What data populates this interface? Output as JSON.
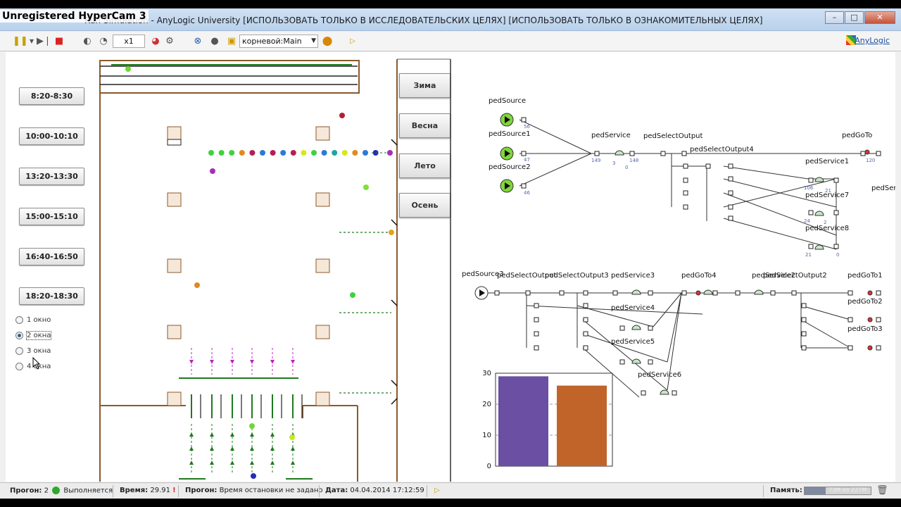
{
  "watermark": "Unregistered HyperCam 3",
  "window": {
    "title": "Run Simulation - AnyLogic University  [ИСПОЛЬЗОВАТЬ ТОЛЬКО В ИССЛЕДОВАТЕЛЬСКИХ ЦЕЛЯХ]  [ИСПОЛЬЗОВАТЬ ТОЛЬКО В ОЗНАКОМИТЕЛЬНЫХ ЦЕЛЯХ]",
    "minimize": "–",
    "maximize": "□",
    "close": "✕"
  },
  "toolbar": {
    "speed": "x1",
    "agent_select": "корневой:Main",
    "brand_link": "AnyLogic"
  },
  "time_buttons": [
    "8:20-8:30",
    "10:00-10:10",
    "13:20-13:30",
    "15:00-15:10",
    "16:40-16:50",
    "18:20-18:30"
  ],
  "windows_radio": {
    "options": [
      "1 окно",
      "2 окна",
      "3 окна",
      "4 окна"
    ],
    "selected_index": 1
  },
  "season_buttons": [
    "Зима",
    "Весна",
    "Лето",
    "Осень"
  ],
  "flowchart": {
    "blocks": [
      {
        "id": "pedSource"
      },
      {
        "id": "pedSource1"
      },
      {
        "id": "pedSource2"
      },
      {
        "id": "pedService"
      },
      {
        "id": "pedSelectOutput"
      },
      {
        "id": "pedSelectOutput4"
      },
      {
        "id": "pedGoTo"
      },
      {
        "id": "pedService1"
      },
      {
        "id": "pedService7"
      },
      {
        "id": "pedService8"
      },
      {
        "id": "pedServices"
      },
      {
        "id": "pedSource3"
      },
      {
        "id": "pedSelectOutput"
      },
      {
        "id": "pedSelectOutput3"
      },
      {
        "id": "pedService3"
      },
      {
        "id": "pedGoTo4"
      },
      {
        "id": "pedService2"
      },
      {
        "id": "pedSelectOutput2"
      },
      {
        "id": "pedGoTo1"
      },
      {
        "id": "pedService4"
      },
      {
        "id": "pedService5"
      },
      {
        "id": "pedService6"
      },
      {
        "id": "pedGoTo2"
      },
      {
        "id": "pedGoTo3"
      }
    ],
    "counts": [
      "56",
      "47",
      "46",
      "149",
      "148",
      "3",
      "0",
      "120",
      "106",
      "21",
      "24",
      "21",
      "2",
      "0"
    ]
  },
  "chart_data": {
    "type": "bar",
    "categories": [
      "",
      ""
    ],
    "values": [
      29,
      26
    ],
    "colors": [
      "#6a4fa3",
      "#c0642a"
    ],
    "ylim": [
      0,
      30
    ],
    "yticks": [
      0,
      10,
      20,
      30
    ],
    "grid": true
  },
  "statusbar": {
    "run_label": "Прогон:",
    "run_value": "2",
    "run_state": "Выполняется",
    "time_label": "Время:",
    "time_value": "29.91",
    "stop_label": "Прогон:",
    "stop_value": "Время остановки не задано",
    "date_label": "Дата:",
    "date_value": "04.04.2014 17:12:59",
    "memory_label": "Память:",
    "memory_value": "73M из 227M",
    "memory_fraction": 0.32
  },
  "colors": {
    "wall": "#8a5a2b",
    "track": "#1e7a1e",
    "agent_palette": [
      "#3fd13f",
      "#2b7bd6",
      "#b51f55",
      "#e08a1e",
      "#d4e81c",
      "#a52fb8",
      "#1ea5a0",
      "#2a2ab8"
    ]
  }
}
